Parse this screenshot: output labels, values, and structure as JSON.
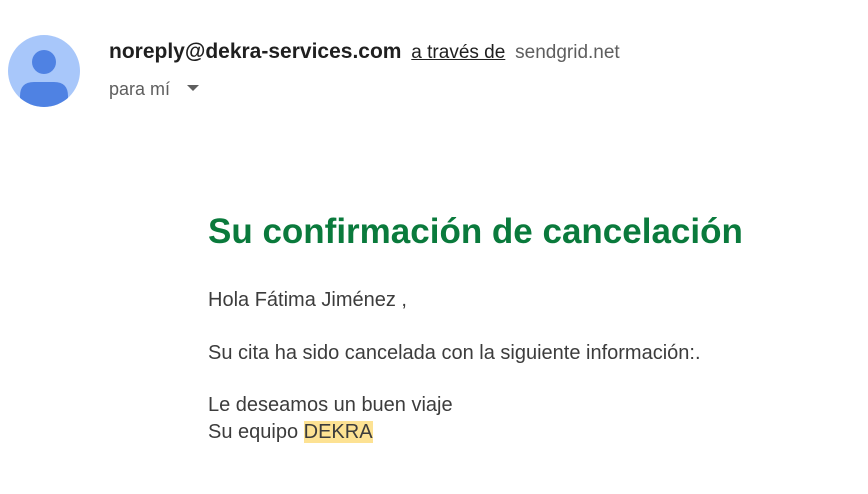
{
  "sender": {
    "email": "noreply@dekra-services.com",
    "via_label": "a través de",
    "via_domain": "sendgrid.net",
    "avatar_icon": "person-avatar-icon",
    "avatar_bg": "#a8c7fa",
    "avatar_fg": "#4f82e3"
  },
  "recipient": {
    "label": "para mí",
    "dropdown_icon": "chevron-down-icon"
  },
  "message": {
    "title": "Su confirmación de cancelación",
    "title_color": "#0a7a3c",
    "greeting": "Hola Fátima Jiménez ,",
    "info": "Su cita ha sido cancelada con la siguiente información:.",
    "farewell": "Le deseamos un buen viaje",
    "signoff_prefix": "Su equipo",
    "signoff_brand": "DEKRA",
    "highlight_color": "#fde293"
  }
}
